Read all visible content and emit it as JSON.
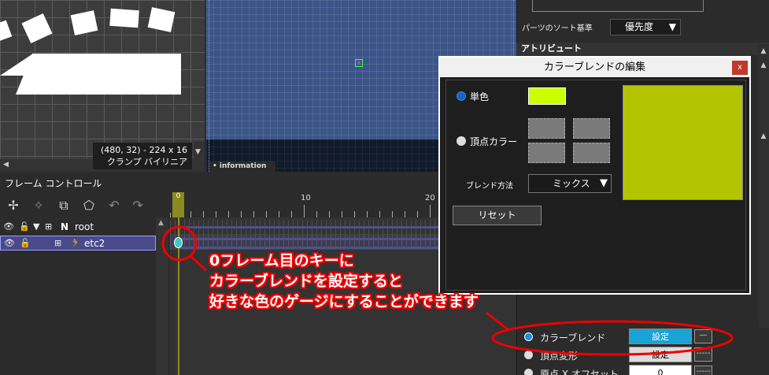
{
  "texture_view": {
    "info_coords": "(480, 32) - 224 x 16",
    "info_mode": "クランプ バイリニア"
  },
  "canvas": {
    "info_tab": "information"
  },
  "right_panel": {
    "sort_label": "パーツのソート基準",
    "sort_value": "優先度",
    "attributes_header": "アトリビュート",
    "rows": [
      {
        "label": "カラーブレンド",
        "button": "設定",
        "dash": "—"
      },
      {
        "label": "頂点変形",
        "button": "設定",
        "dash": "-----"
      },
      {
        "label": "原点 X オフセット",
        "button": "0",
        "dash": "-----"
      }
    ]
  },
  "frame_control": {
    "title": "フレーム コントロール"
  },
  "layers": [
    {
      "name": "root",
      "type_letter": "N"
    },
    {
      "name": "etc2"
    }
  ],
  "timeline": {
    "playhead_frame": "0",
    "tick_labels": [
      "10",
      "20"
    ]
  },
  "dialog": {
    "title": "カラーブレンドの編集",
    "close": "x",
    "single_color_label": "単色",
    "vertex_color_label": "頂点カラー",
    "blend_method_label": "ブレンド方法",
    "blend_method_value": "ミックス",
    "reset_label": "リセット",
    "single_color": "#ccff00",
    "preview_color": "#b3c400"
  },
  "annotation": {
    "line1": "0フレーム目のキーに",
    "line2": "カラーブレンドを設定すると",
    "line3": "好きな色のゲージにすることができます"
  }
}
